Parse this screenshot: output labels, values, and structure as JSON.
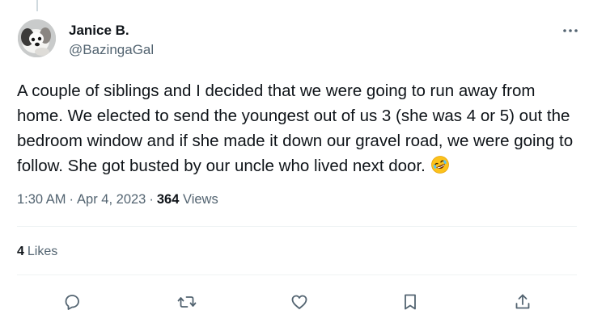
{
  "tweet": {
    "author": {
      "name": "Janice B.",
      "handle": "@BazingaGal"
    },
    "text": "A couple of siblings and I decided that we were going to run away from home. We elected to send the youngest out of us 3 (she was 4 or 5) out the bedroom window and if she made it down our gravel road, we were going to follow. She got busted by our uncle who lived next door.",
    "emoji": "rolling-on-floor-laughing",
    "time": "1:30 AM",
    "date": "Apr 4, 2023",
    "separator": "·",
    "views_count": "364",
    "views_label": "Views",
    "likes_count": "4",
    "likes_label": "Likes"
  },
  "icons": {
    "more": "more-horizontal-icon",
    "reply": "reply-icon",
    "retweet": "retweet-icon",
    "like": "heart-icon",
    "bookmark": "bookmark-icon",
    "share": "share-icon"
  },
  "colors": {
    "text_primary": "#0f1419",
    "text_secondary": "#536471",
    "divider": "#eff3f4",
    "thread_line": "#cfd9de"
  }
}
